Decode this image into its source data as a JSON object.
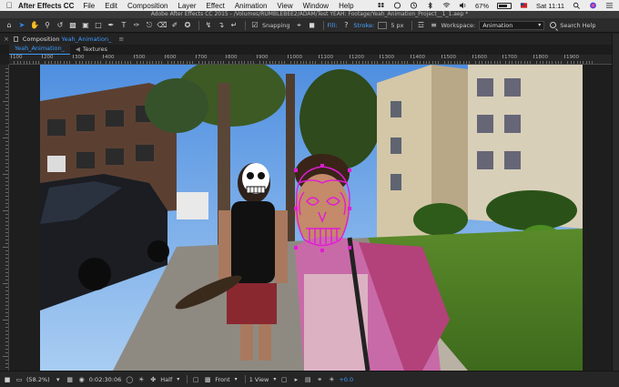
{
  "menubar": {
    "app_name": "After Effects CC",
    "items": [
      "File",
      "Edit",
      "Composition",
      "Layer",
      "Effect",
      "Animation",
      "View",
      "Window",
      "Help"
    ],
    "battery": "67%",
    "clock": "Sat 11:11"
  },
  "window_title": "Adobe After Effects CC 2015 - /Volumes/RUMBLEBEE2/ADAM/Test YEAH: Footage/Yeah_Animation_Project__1_1.aep *",
  "toolbar": {
    "snapping_label": "Snapping",
    "fill_label": "Fill:",
    "stroke_label": "Stroke:",
    "stroke_px": "5 px",
    "workspace_label": "Workspace:",
    "workspace_value": "Animation",
    "search_help": "Search Help",
    "accent_color": "#2d8ceb"
  },
  "panel": {
    "label": "Composition",
    "comp_name": "Yeah_Animation_"
  },
  "tabs": [
    {
      "label": "Yeah_Animation_"
    },
    {
      "label": "Textures"
    }
  ],
  "ruler": {
    "labels": [
      "100",
      "200",
      "300",
      "400",
      "500",
      "600",
      "700",
      "800",
      "900",
      "1000",
      "1100",
      "1200",
      "1300",
      "1400",
      "1500",
      "1600",
      "1700",
      "1800",
      "1900"
    ]
  },
  "bottombar": {
    "zoom": "(58.2%)",
    "timecode": "0:02:30:06",
    "resolution": "Half",
    "view": "Front",
    "views": "1 View",
    "exposure": "+0.0"
  },
  "icons": {
    "toolbar": [
      "home-icon",
      "selection-tool-icon",
      "hand-tool-icon",
      "zoom-tool-icon",
      "rotation-tool-icon",
      "camera-tool-icon",
      "pan-behind-tool-icon",
      "rectangle-tool-icon",
      "pen-tool-icon",
      "type-tool-icon",
      "brush-tool-icon",
      "clone-stamp-tool-icon",
      "eraser-tool-icon",
      "roto-brush-tool-icon",
      "puppet-tool-icon"
    ]
  }
}
